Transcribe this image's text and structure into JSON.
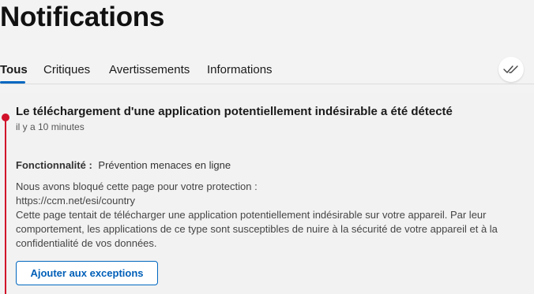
{
  "page": {
    "title": "Notifications"
  },
  "tabs": [
    {
      "label": "Tous",
      "active": true
    },
    {
      "label": "Critiques",
      "active": false
    },
    {
      "label": "Avertissements",
      "active": false
    },
    {
      "label": "Informations",
      "active": false
    }
  ],
  "toolbar": {
    "mark_all_read_icon": "double-check-icon"
  },
  "notification": {
    "severity_color": "#d1102a",
    "title": "Le téléchargement d'une application potentiellement indésirable a été détecté",
    "time": "il y a 10 minutes",
    "feature_label": "Fonctionnalité :",
    "feature_value": "Prévention menaces en ligne",
    "body_lines": [
      "Nous avons bloqué cette page pour votre protection :",
      "https://ccm.net/esi/country",
      "Cette page tentait de télécharger une application potentiellement indésirable sur votre appareil. Par leur",
      "comportement, les applications de ce type sont susceptibles de nuire à la sécurité de votre appareil et à la",
      "confidentialité de vos données."
    ],
    "action_label": "Ajouter aux exceptions"
  },
  "colors": {
    "accent": "#0067c0",
    "background": "#f3f3f3"
  }
}
